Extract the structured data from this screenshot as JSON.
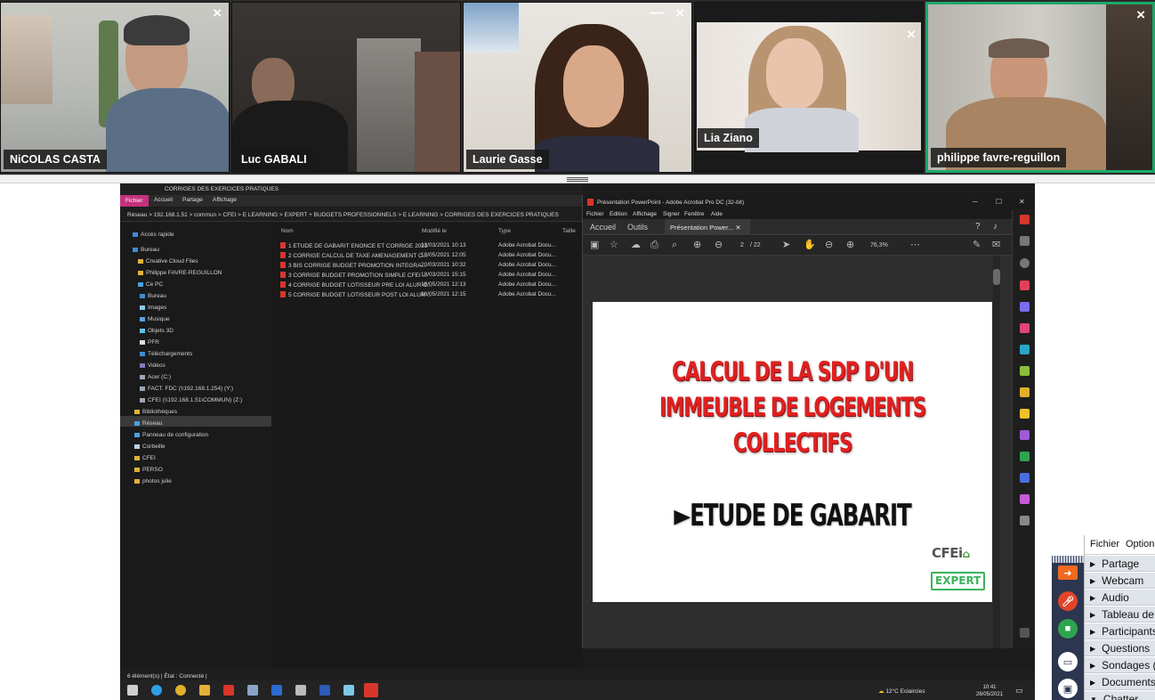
{
  "participants": [
    {
      "name": "NiCOLAS CASTA"
    },
    {
      "name": "Luc GABALI"
    },
    {
      "name": "Laurie Gasse"
    },
    {
      "name": "Lia Ziano"
    },
    {
      "name": "philippe favre-reguillon",
      "active": true
    }
  ],
  "tile_close_glyph": "×",
  "tile_minimize_glyph": "—",
  "explorer": {
    "title": "CORRIGES DES EXERCICES PRATIQUES",
    "ribbon": {
      "file": "Fichier",
      "home": "Accueil",
      "share": "Partage",
      "view": "Affichage"
    },
    "path": "Réseau  >  192.168.1.51  >  commun  >  CFEI  >  E LEARNING  >  EXPERT + BUDGETS PROFESSIONNELS  >  E LEARNING  >  CORRIGES DES EXERCICES PRATIQUES",
    "nav": [
      "Accès rapide",
      "Bureau",
      "Creative Cloud Files",
      "Philippe FAVRE-REGUILLON",
      "Ce PC",
      "Bureau",
      "Images",
      "Musique",
      "Objets 3D",
      "PFR",
      "Téléchargements",
      "Vidéos",
      "Acer (C:)",
      "FACT. FDC (\\\\192.168.1.254) (Y:)",
      "CFEI (\\\\192.168.1.51\\COMMUN) (Z:)",
      "Bibliothèques",
      "Réseau",
      "Panneau de configuration",
      "Corbeille",
      "CFEI",
      "PERSO",
      "photos julie"
    ],
    "columns": {
      "name": "Nom",
      "modified": "Modifié le",
      "type": "Type",
      "size": "Taille"
    },
    "files": [
      {
        "name": "1 ETUDE DE GABARIT ENONCE ET CORRIGE 2021",
        "modified": "13/03/2021 10:13",
        "type": "Adobe Acrobat Docu..."
      },
      {
        "name": "2 CORRIGE CALCUL DE TAXE AMENAGEMENT C...",
        "modified": "18/05/2021 12:05",
        "type": "Adobe Acrobat Docu..."
      },
      {
        "name": "3 BIS CORRIGE BUDGET PROMOTION INTEGRA...",
        "modified": "20/03/2021 10:32",
        "type": "Adobe Acrobat Docu..."
      },
      {
        "name": "3 CORRIGE BUDGET PROMOTION SIMPLE CFEI ...",
        "modified": "18/03/2021 15:15",
        "type": "Adobe Acrobat Docu..."
      },
      {
        "name": "4 CORRIGE BUDGET LOTISSEUR PRE LOI ALUR C...",
        "modified": "18/05/2021 12:13",
        "type": "Adobe Acrobat Docu..."
      },
      {
        "name": "5 CORRIGE BUDGET LOTISSEUR POST LOI ALUR ...",
        "modified": "18/05/2021 12:15",
        "type": "Adobe Acrobat Docu..."
      }
    ],
    "status": "6 élément(s)  |  État :  Connecté  |"
  },
  "acrobat": {
    "title": "Présentation PowerPoint - Adobe Acrobat Pro DC (32-bit)",
    "menu": [
      "Fichier",
      "Edition",
      "Affichage",
      "Signer",
      "Fenêtre",
      "Aide"
    ],
    "tab_home": "Accueil",
    "tab_tools": "Outils",
    "doc_tab": "Présentation Power...",
    "page_current": "2",
    "page_total": "/ 22",
    "zoom": "76,3%"
  },
  "slide": {
    "line1": "CALCUL DE LA SDP D'UN",
    "line2": "IMMEUBLE DE LOGEMENTS",
    "line3": "COLLECTIFS",
    "subtitle": "►ETUDE DE GABARIT",
    "logo_text": "CFEi",
    "badge": "EXPERT"
  },
  "taskbar": {
    "weather": "12°C  Eclaircies",
    "time": "10:41",
    "date": "26/05/2021"
  },
  "panel": {
    "menu_file": "Fichier",
    "menu_options": "Options",
    "sections": [
      "Partage",
      "Webcam",
      "Audio",
      "Tableau de",
      "Participants",
      "Questions",
      "Sondages (",
      "Documents",
      "Chatter"
    ]
  },
  "colors": {
    "active_border": "#1ca86a",
    "slide_red": "#e02020",
    "control_bar": "#2c3650",
    "mic_button": "#e0452a",
    "cam_button": "#2ea44f",
    "share_button": "#f06a1f"
  }
}
